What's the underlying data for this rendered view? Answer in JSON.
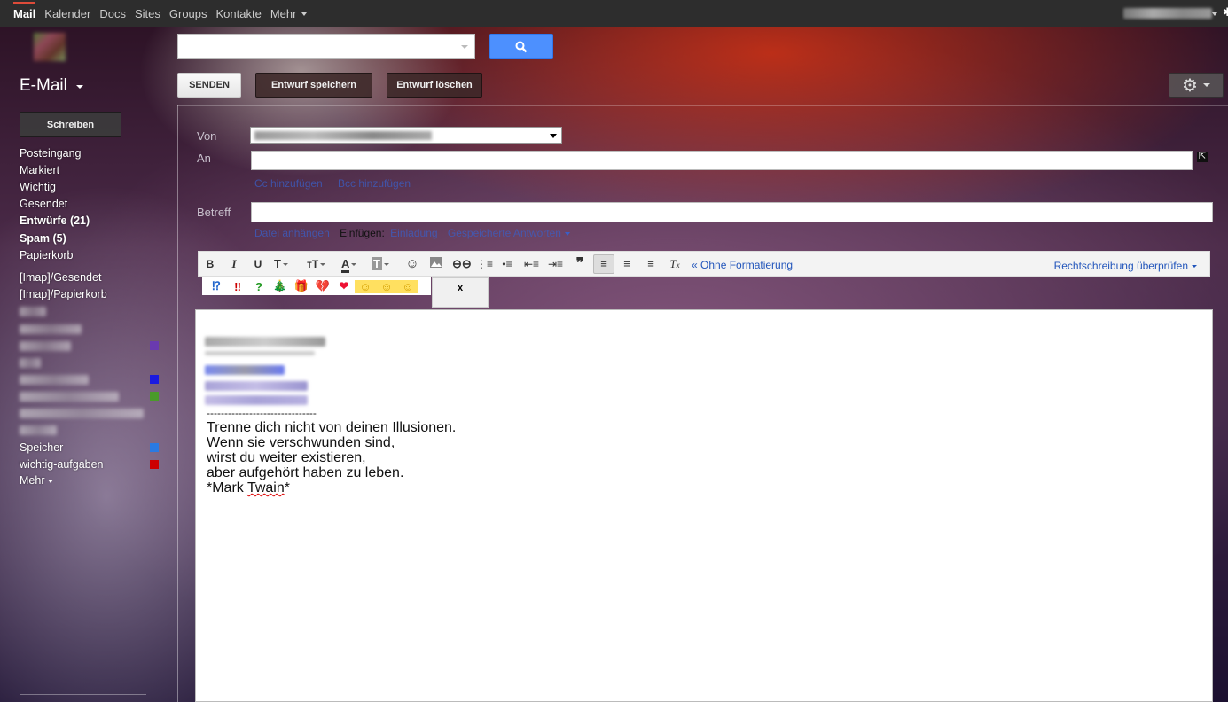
{
  "topnav": {
    "items": [
      "Mail",
      "Kalender",
      "Docs",
      "Sites",
      "Groups",
      "Kontakte",
      "Mehr"
    ]
  },
  "header": {
    "title": "E-Mail",
    "send_label": "SENDEN",
    "save_draft_label": "Entwurf speichern",
    "delete_draft_label": "Entwurf löschen"
  },
  "sidebar": {
    "compose_label": "Schreiben",
    "items": [
      {
        "label": "Posteingang",
        "bold": false
      },
      {
        "label": "Markiert",
        "bold": false
      },
      {
        "label": "Wichtig",
        "bold": false
      },
      {
        "label": "Gesendet",
        "bold": false
      },
      {
        "label": "Entwürfe (21)",
        "bold": true
      },
      {
        "label": "Spam (5)",
        "bold": true
      },
      {
        "label": "Papierkorb",
        "bold": false
      }
    ],
    "labels": [
      {
        "label": "[Imap]/Gesendet"
      },
      {
        "label": "[Imap]/Papierkorb"
      }
    ],
    "colored_labels": [
      {
        "label": "Speicher",
        "color": "#2a7ae2"
      },
      {
        "label": "wichtig-aufgaben",
        "color": "#cc0000"
      }
    ],
    "more_label": "Mehr",
    "swatch_colors": [
      "#6a3ab0",
      "#1a1ae0",
      "#4a9a2a"
    ]
  },
  "compose": {
    "from_label": "Von",
    "to_label": "An",
    "cc_link": "Cc hinzufügen",
    "bcc_link": "Bcc hinzufügen",
    "subject_label": "Betreff",
    "attach_link": "Datei anhängen",
    "insert_label": "Einfügen:",
    "invite_link": "Einladung",
    "canned_link": "Gespeicherte Antworten",
    "no_format_link": "« Ohne Formatierung",
    "spellcheck_link": "Rechtschreibung überprüfen",
    "emoji_close": "x",
    "signature_separator": "-------------------------------",
    "quote_lines": [
      "Trenne dich nicht von deinen Illusionen.",
      "Wenn sie verschwunden sind,",
      "wirst du weiter existieren,",
      "aber aufgehört haben zu leben."
    ],
    "quote_author_prefix": "*Mark ",
    "quote_author_name": "Twain",
    "quote_author_suffix": "*"
  },
  "toolbar_icons": [
    "bold-icon",
    "italic-icon",
    "underline-icon",
    "font-icon",
    "font-size-icon",
    "text-color-icon",
    "highlight-icon",
    "emoji-icon",
    "image-icon",
    "link-icon",
    "numbered-list-icon",
    "bullet-list-icon",
    "outdent-icon",
    "indent-icon",
    "quote-icon",
    "align-left-icon",
    "align-center-icon",
    "align-right-icon",
    "clear-format-icon"
  ],
  "emoji": [
    "⁉",
    "‼",
    "?",
    "🎄",
    "🎁",
    "💔",
    "❤",
    "☺",
    "☺",
    "☺"
  ]
}
